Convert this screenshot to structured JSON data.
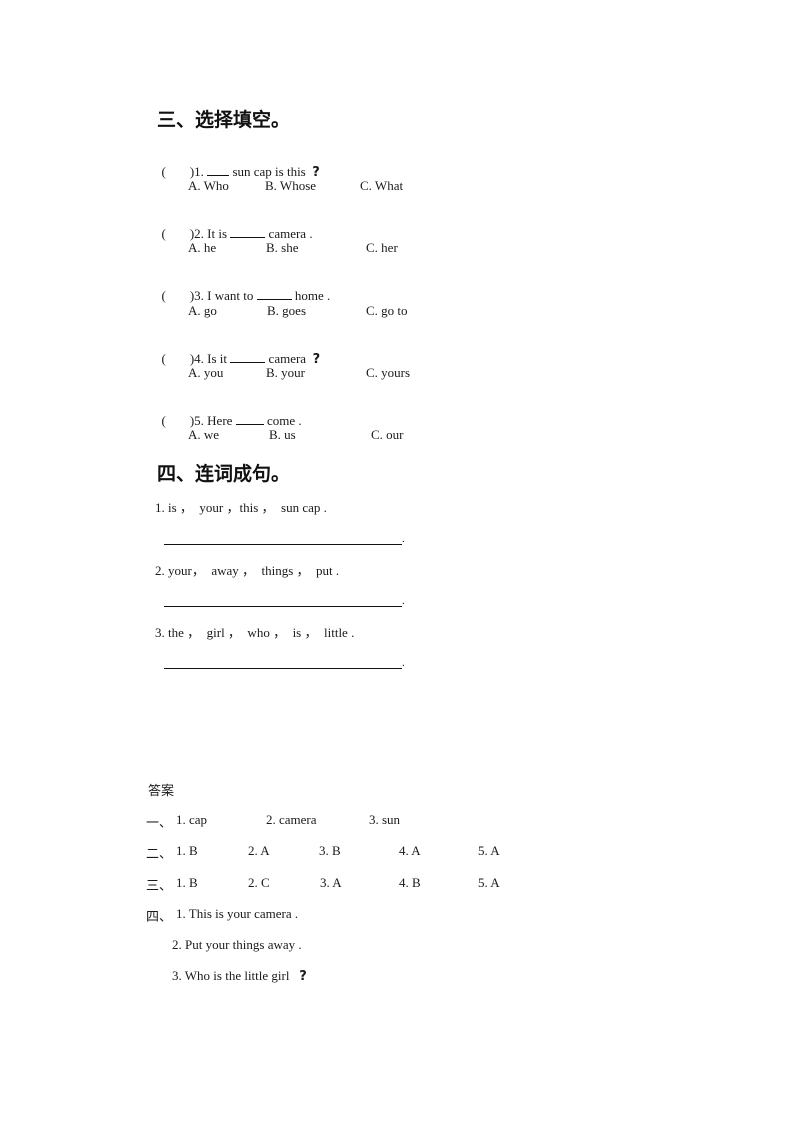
{
  "section3": {
    "title": "三、选择填空。",
    "questions": [
      {
        "paren_open": "(",
        "prefix": ")1. ",
        "after_blank": " sun cap is this",
        "qmark": "?",
        "options": [
          "A. Who",
          "B. Whose",
          "C. What"
        ]
      },
      {
        "paren_open": "(",
        "prefix": ")2. It is ",
        "after_blank": " camera .",
        "qmark": "",
        "options": [
          "A. he",
          "B. she",
          "C. her"
        ]
      },
      {
        "paren_open": "(",
        "prefix": ")3. I want to ",
        "after_blank": " home .",
        "qmark": "",
        "options": [
          "A. go",
          "B. goes",
          "C. go to"
        ]
      },
      {
        "paren_open": "(",
        "prefix": ")4. Is it ",
        "after_blank": " camera",
        "qmark": "?",
        "options": [
          "A. you",
          "B. your",
          "C. yours"
        ]
      },
      {
        "paren_open": "(",
        "prefix": ")5. Here ",
        "after_blank": " come .",
        "qmark": "",
        "options": [
          "A. we",
          "B. us",
          "C. our"
        ]
      }
    ]
  },
  "section4": {
    "title": "四、连词成句。",
    "items": [
      {
        "prompt": "1. is ，  your ，this ，  sun cap .",
        "line_end": "."
      },
      {
        "prompt": "2. your，  away ，  things ，  put .",
        "line_end": "."
      },
      {
        "prompt": "3. the ，  girl ，  who ，  is ，  little .",
        "line_end": "."
      }
    ]
  },
  "answers": {
    "title": "答案",
    "rows": [
      {
        "label": "一、",
        "items": [
          "1. cap",
          "2. camera",
          "3. sun"
        ]
      },
      {
        "label": "二、",
        "items": [
          "1. B",
          "2. A",
          "3. B",
          "4. A",
          "5. A"
        ]
      },
      {
        "label": "三、",
        "items": [
          "1. B",
          "2. C",
          "3. A",
          "4. B",
          "5. A"
        ]
      }
    ],
    "section4": {
      "label": "四、",
      "lines": [
        "1. This is your camera .",
        "2. Put your things away .",
        "3. Who is the little girl"
      ],
      "last_qmark": "?"
    }
  }
}
